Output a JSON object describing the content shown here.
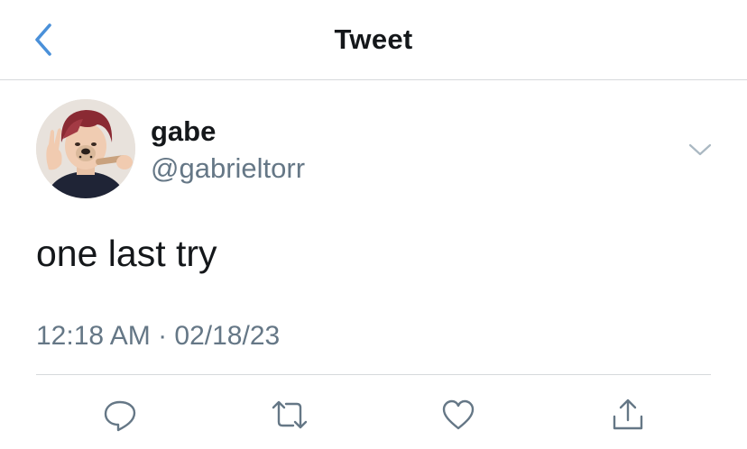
{
  "nav": {
    "title": "Tweet",
    "back_icon": "chevron-left-icon",
    "accent_color": "#4a90d9"
  },
  "tweet": {
    "author": {
      "display_name": "gabe",
      "handle": "@gabrieltorr"
    },
    "text": "one last try",
    "timestamp": "12:18 AM · 02/18/23"
  },
  "actions": [
    {
      "icon": "reply-icon"
    },
    {
      "icon": "retweet-icon"
    },
    {
      "icon": "like-icon"
    },
    {
      "icon": "share-icon"
    }
  ],
  "colors": {
    "secondary_text": "#657786",
    "primary_text": "#14171a",
    "divider": "#d6d9dc"
  }
}
